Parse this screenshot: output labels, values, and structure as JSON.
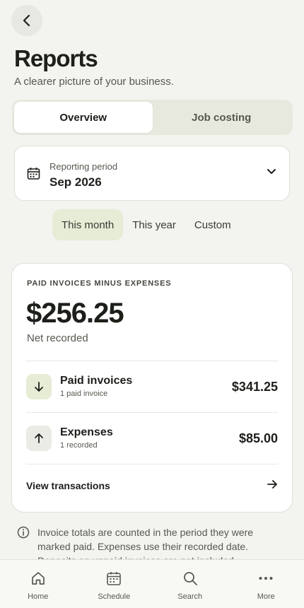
{
  "header": {
    "title": "Reports",
    "subtitle": "A clearer picture of your business."
  },
  "tabs": [
    {
      "label": "Overview",
      "active": true
    },
    {
      "label": "Job costing",
      "active": false
    }
  ],
  "period": {
    "label": "Reporting period",
    "value": "Sep 2026"
  },
  "ranges": [
    {
      "label": "This month",
      "active": true
    },
    {
      "label": "This year",
      "active": false
    },
    {
      "label": "Custom",
      "active": false
    }
  ],
  "summary": {
    "caption": "PAID INVOICES MINUS EXPENSES",
    "net_amount": "$256.25",
    "net_label": "Net recorded",
    "rows": [
      {
        "title": "Paid invoices",
        "sub": "1 paid invoice",
        "amount": "$341.25",
        "icon": "arrow-down-icon"
      },
      {
        "title": "Expenses",
        "sub": "1 recorded",
        "amount": "$85.00",
        "icon": "arrow-up-icon"
      }
    ],
    "view_label": "View transactions"
  },
  "info_text": "Invoice totals are counted in the period they were marked paid. Expenses use their recorded date. Deposits on unpaid invoices are not included.",
  "nav": [
    {
      "label": "Home",
      "icon": "home-icon"
    },
    {
      "label": "Schedule",
      "icon": "calendar-icon"
    },
    {
      "label": "Search",
      "icon": "search-icon"
    },
    {
      "label": "More",
      "icon": "more-icon"
    }
  ],
  "colors": {
    "background": "#f3f3ef",
    "accent_soft": "#e6ecd5",
    "text": "#1c1f1a",
    "muted": "#55594f"
  }
}
